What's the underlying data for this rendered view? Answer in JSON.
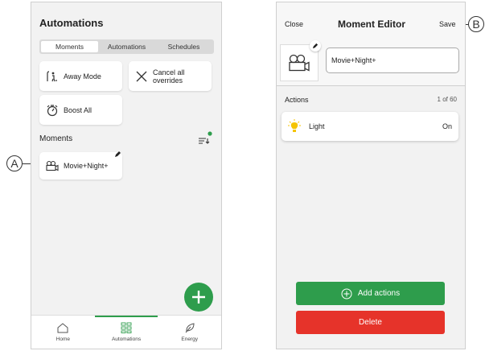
{
  "callouts": {
    "a": "A",
    "b": "B"
  },
  "left": {
    "title": "Automations",
    "tabs": [
      {
        "label": "Moments",
        "active": true
      },
      {
        "label": "Automations",
        "active": false
      },
      {
        "label": "Schedules",
        "active": false
      }
    ],
    "quick_actions": [
      {
        "label": "Away Mode",
        "icon": "away-mode-icon"
      },
      {
        "label": "Cancel all overrides",
        "icon": "close-icon"
      },
      {
        "label": "Boost All",
        "icon": "timer-icon"
      }
    ],
    "section_title": "Moments",
    "moment": {
      "label": "Movie+Night+",
      "icon": "camera-icon"
    },
    "nav": [
      {
        "label": "Home",
        "icon": "home-icon"
      },
      {
        "label": "Automations",
        "icon": "grid-icon",
        "active": true
      },
      {
        "label": "Energy",
        "icon": "leaf-icon"
      }
    ],
    "accent": "#2e9d4c"
  },
  "right": {
    "close": "Close",
    "title": "Moment Editor",
    "save": "Save",
    "name_value": "Movie+Night+",
    "actions_label": "Actions",
    "actions_count": "1 of 60",
    "action": {
      "label": "Light",
      "value": "On",
      "icon": "bulb-icon"
    },
    "add_button": "Add actions",
    "delete_button": "Delete",
    "colors": {
      "add": "#2e9d4c",
      "delete": "#e6332a"
    }
  }
}
